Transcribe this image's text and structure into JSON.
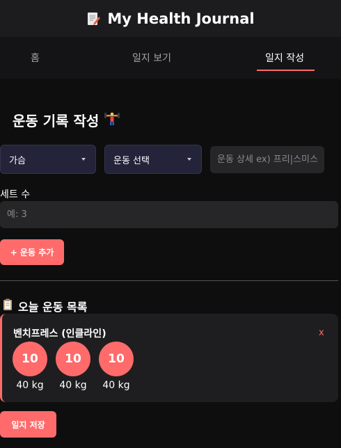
{
  "header": {
    "title": "My Health Journal",
    "icon": "memo-icon"
  },
  "nav": {
    "tabs": [
      {
        "label": "홈"
      },
      {
        "label": "일지 보기"
      },
      {
        "label": "일지 작성",
        "active": true
      }
    ]
  },
  "form": {
    "title": "운동 기록 작성",
    "title_icon": "weight-lifter-icon",
    "body_part": "가슴",
    "exercise": "운동 선택",
    "detail_placeholder": "운동 상세 ex) 프리|스미스",
    "sets_label": "세트 수",
    "sets_placeholder": "예: 3",
    "add_button": "+ 운동 추가"
  },
  "today": {
    "title": "오늘 운동 목록",
    "title_icon": "clipboard-icon",
    "exercises": [
      {
        "name": "벤치프레스 (인클라인)",
        "remove": "x",
        "sets": [
          {
            "reps": "10",
            "weight": "40 kg"
          },
          {
            "reps": "10",
            "weight": "40 kg"
          },
          {
            "reps": "10",
            "weight": "40 kg"
          }
        ]
      }
    ]
  },
  "save_button": "일지 저장",
  "colors": {
    "accent": "#ff6b6b",
    "background": "#0e0e0f",
    "header": "#1c1c1e",
    "card": "#1e1e20"
  }
}
